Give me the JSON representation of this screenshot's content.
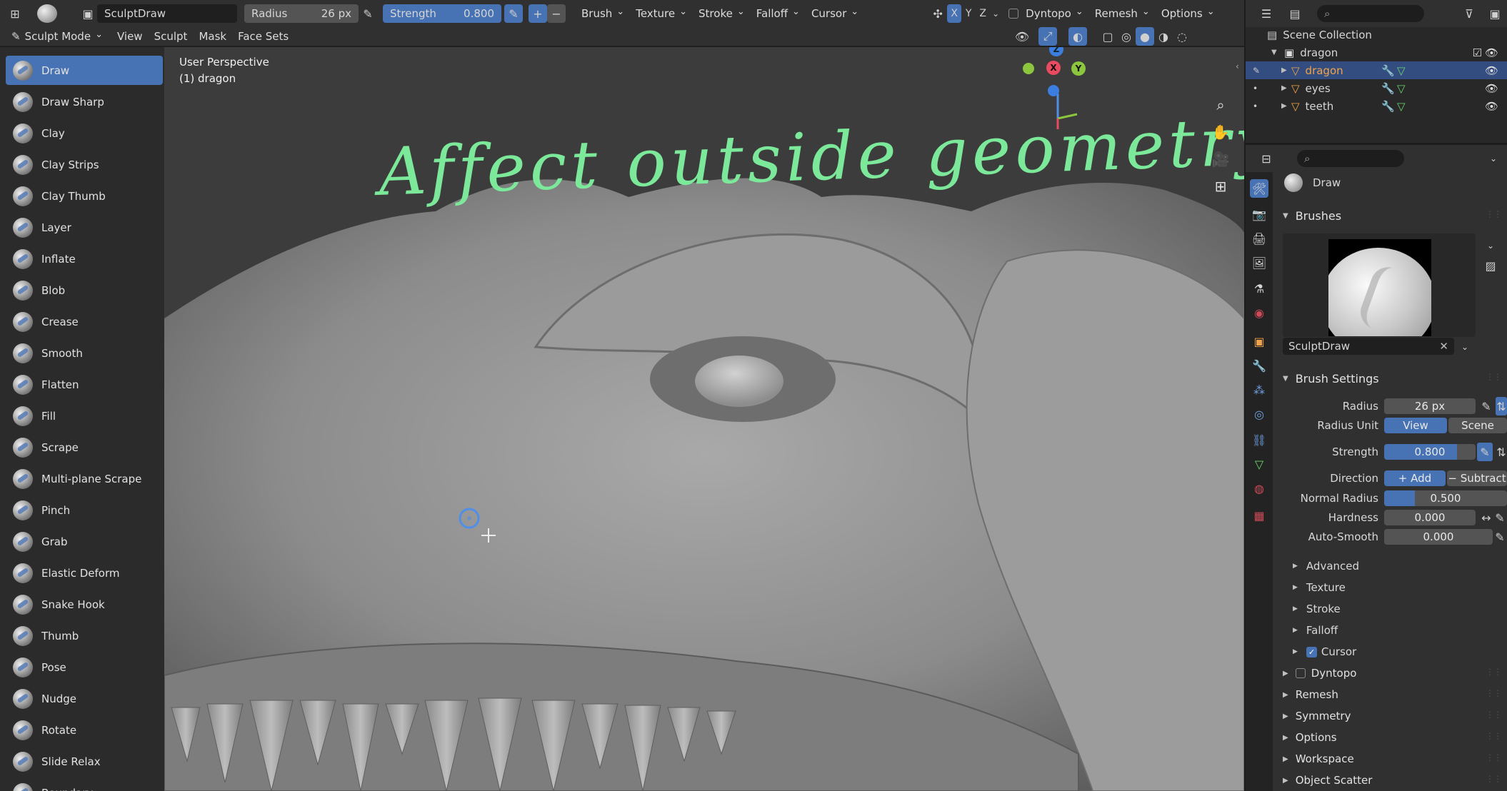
{
  "header": {
    "brush_name": "SculptDraw",
    "radius_label": "Radius",
    "radius_value": "26 px",
    "strength_label": "Strength",
    "strength_value": "0.800",
    "menus": [
      "Brush",
      "Texture",
      "Stroke",
      "Falloff",
      "Cursor"
    ],
    "axes": [
      "X",
      "Y",
      "Z"
    ],
    "dyntopo": "Dyntopo",
    "remesh": "Remesh",
    "options": "Options"
  },
  "modebar": {
    "mode": "Sculpt Mode",
    "menus": [
      "View",
      "Sculpt",
      "Mask",
      "Face Sets"
    ]
  },
  "tools": [
    {
      "label": "Draw",
      "active": true
    },
    {
      "label": "Draw Sharp"
    },
    {
      "label": "Clay"
    },
    {
      "label": "Clay Strips"
    },
    {
      "label": "Clay Thumb"
    },
    {
      "label": "Layer"
    },
    {
      "label": "Inflate"
    },
    {
      "label": "Blob"
    },
    {
      "label": "Crease"
    },
    {
      "label": "Smooth"
    },
    {
      "label": "Flatten"
    },
    {
      "label": "Fill"
    },
    {
      "label": "Scrape"
    },
    {
      "label": "Multi-plane Scrape"
    },
    {
      "label": "Pinch"
    },
    {
      "label": "Grab"
    },
    {
      "label": "Elastic Deform"
    },
    {
      "label": "Snake Hook"
    },
    {
      "label": "Thumb"
    },
    {
      "label": "Pose"
    },
    {
      "label": "Nudge"
    },
    {
      "label": "Rotate"
    },
    {
      "label": "Slide Relax"
    },
    {
      "label": "Boundary"
    }
  ],
  "viewport": {
    "view_name": "User Perspective",
    "object_name": "(1) dragon",
    "annotation": "Affect outside geometry",
    "gizmo": {
      "z": "Z",
      "x": "X",
      "y": "Y"
    }
  },
  "outliner": {
    "root": "Scene Collection",
    "collection": "dragon",
    "objects": [
      {
        "name": "dragon",
        "selected": true
      },
      {
        "name": "eyes"
      },
      {
        "name": "teeth"
      }
    ]
  },
  "properties": {
    "active_tool": "Draw",
    "brushes_section": "Brushes",
    "brush_name": "SculptDraw",
    "brush_settings_section": "Brush Settings",
    "radius_label": "Radius",
    "radius_value": "26 px",
    "radius_unit_label": "Radius Unit",
    "radius_unit_view": "View",
    "radius_unit_scene": "Scene",
    "strength_label": "Strength",
    "strength_value": "0.800",
    "strength_fraction": 0.8,
    "direction_label": "Direction",
    "direction_add": "Add",
    "direction_subtract": "Subtract",
    "normal_radius_label": "Normal Radius",
    "normal_radius_value": "0.500",
    "normal_radius_fraction": 0.25,
    "hardness_label": "Hardness",
    "hardness_value": "0.000",
    "autosmooth_label": "Auto-Smooth",
    "autosmooth_value": "0.000",
    "subsections": [
      "Advanced",
      "Texture",
      "Stroke",
      "Falloff",
      "Cursor"
    ],
    "cursor_checked": true,
    "panels": [
      "Dyntopo",
      "Remesh",
      "Symmetry",
      "Options",
      "Workspace",
      "Object Scatter"
    ]
  },
  "colors": {
    "accent": "#4772b3",
    "annotation": "#7be89a",
    "object_icon": "#f0a348",
    "panel_bg": "#303030"
  }
}
